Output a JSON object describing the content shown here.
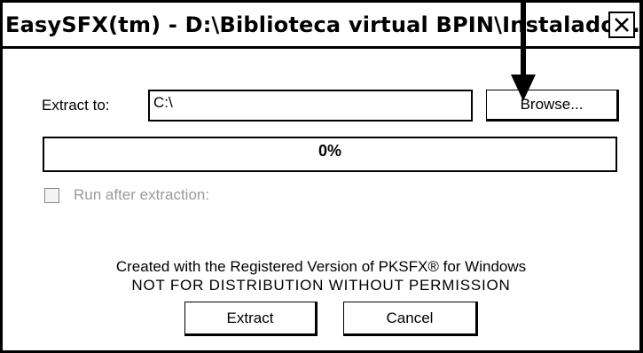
{
  "window": {
    "title": "EasySFX(tm) - D:\\Biblioteca virtual BPIN\\Instalado..."
  },
  "form": {
    "extract_label": "Extract to:",
    "path_value": "C:\\",
    "browse_label": "Browse..."
  },
  "progress": {
    "percent_text": "0%",
    "value": 0
  },
  "options": {
    "run_after_label": "Run after extraction:",
    "run_after_checked": false,
    "run_after_enabled": false
  },
  "credits": {
    "line1": "Created with the Registered Version of PKSFX® for Windows",
    "line2": "NOT FOR DISTRIBUTION WITHOUT PERMISSION"
  },
  "buttons": {
    "extract_label": "Extract",
    "cancel_label": "Cancel"
  },
  "icons": {
    "close": "close-icon",
    "annotation": "down-arrow-icon"
  }
}
